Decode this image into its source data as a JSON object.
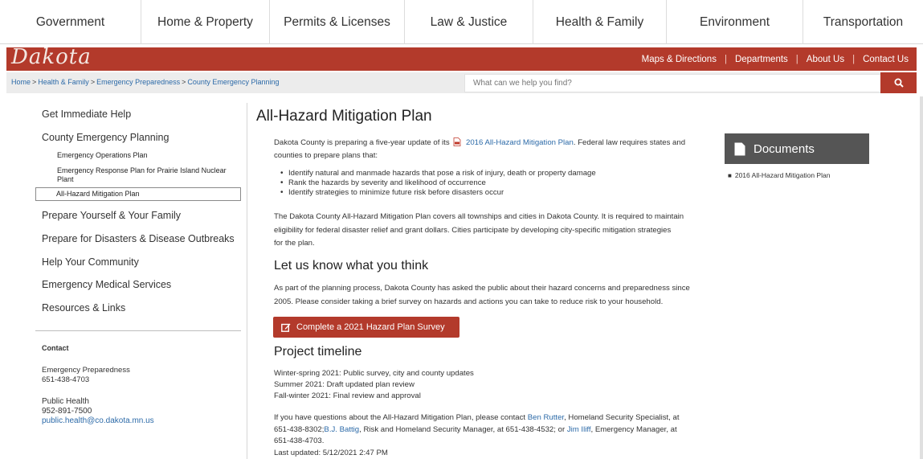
{
  "topnav": [
    "Government",
    "Home & Property",
    "Permits & Licenses",
    "Law & Justice",
    "Health & Family",
    "Environment",
    "Transportation"
  ],
  "banner": {
    "logo": "Dakota",
    "links": [
      "Maps & Directions",
      "Departments",
      "About Us",
      "Contact Us"
    ],
    "separator": "|"
  },
  "breadcrumb": [
    "Home",
    "Health & Family",
    "Emergency Preparedness",
    "County Emergency Planning"
  ],
  "breadcrumb_sep": ">",
  "search": {
    "placeholder": "What can we help you find?"
  },
  "leftnav": {
    "get_help": "Get Immediate Help",
    "county_planning": "County Emergency Planning",
    "sub1": "Emergency Operations Plan",
    "sub2_line1": "Emergency Response Plan for Prairie Island Nuclear",
    "sub2_line2": "Plant",
    "sub3": "All-Hazard Mitigation Plan",
    "prepare_yourself": "Prepare Yourself & Your Family",
    "prepare_disasters": "Prepare for Disasters & Disease Outbreaks",
    "help_community": "Help Your Community",
    "ems": "Emergency Medical Services",
    "resources": "Resources & Links"
  },
  "contact": {
    "heading": "Contact",
    "ep_name": "Emergency Preparedness",
    "ep_phone": "651-438-4703",
    "ph_name": "Public Health",
    "ph_phone": "952-891-7500",
    "ph_email": "public.health@co.dakota.mn.us"
  },
  "main": {
    "title": "All-Hazard Mitigation Plan",
    "intro_a": "Dakota County is preparing a five-year update of its",
    "intro_link": "2016 All-Hazard Mitigation Plan",
    "intro_b": ". Federal law requires states and",
    "intro_c": "counties to prepare plans that:",
    "bullets": [
      "Identify natural and manmade hazards that pose a risk of injury, death or property damage",
      "Rank the hazards by severity and likelihood of occurrence",
      "Identify strategies to minimize future risk before disasters occur"
    ],
    "para2_l1": "The Dakota County All-Hazard Mitigation Plan covers all townships and cities in Dakota County. It is required to maintain",
    "para2_l2": "eligibility for federal disaster relief and grant dollars. Cities participate by developing city-specific mitigation strategies",
    "para2_l3": "for the plan.",
    "h_feedback": "Let us know what you think",
    "para3_l1": "As part of the planning process, Dakota County has asked the public about their hazard concerns and preparedness since",
    "para3_l2": "2005.  Please consider taking a brief survey on hazards and actions you can take to reduce risk to your household.",
    "survey_button": "Complete a 2021 Hazard Plan Survey",
    "h_timeline": "Project timeline",
    "timeline": [
      "Winter-spring 2021: Public survey, city and county updates",
      "Summer 2021: Draft updated plan review",
      "Fall-winter 2021:  Final review and approval"
    ],
    "q_a": "If you have questions about the All-Hazard Mitigation Plan, please contact",
    "q_ben": "Ben Rutter",
    "q_b": ", Homeland Security Specialist, at",
    "q_c": "651-438-8302;",
    "q_bj": "B.J. Battig",
    "q_d": ", Risk and Homeland Security Manager, at 651-438-4532; or",
    "q_jim": "Jim Iliff",
    "q_e": ", Emergency Manager, at",
    "q_f": "651-438-4703.",
    "last_updated": "Last updated: 5/12/2021 2:47 PM"
  },
  "documents": {
    "heading": "Documents",
    "items": [
      "2016 All-Hazard Mitigation Plan"
    ]
  },
  "colors": {
    "brand": "#b33a2b",
    "link": "#2c6aa8",
    "docs_header": "#555555"
  }
}
